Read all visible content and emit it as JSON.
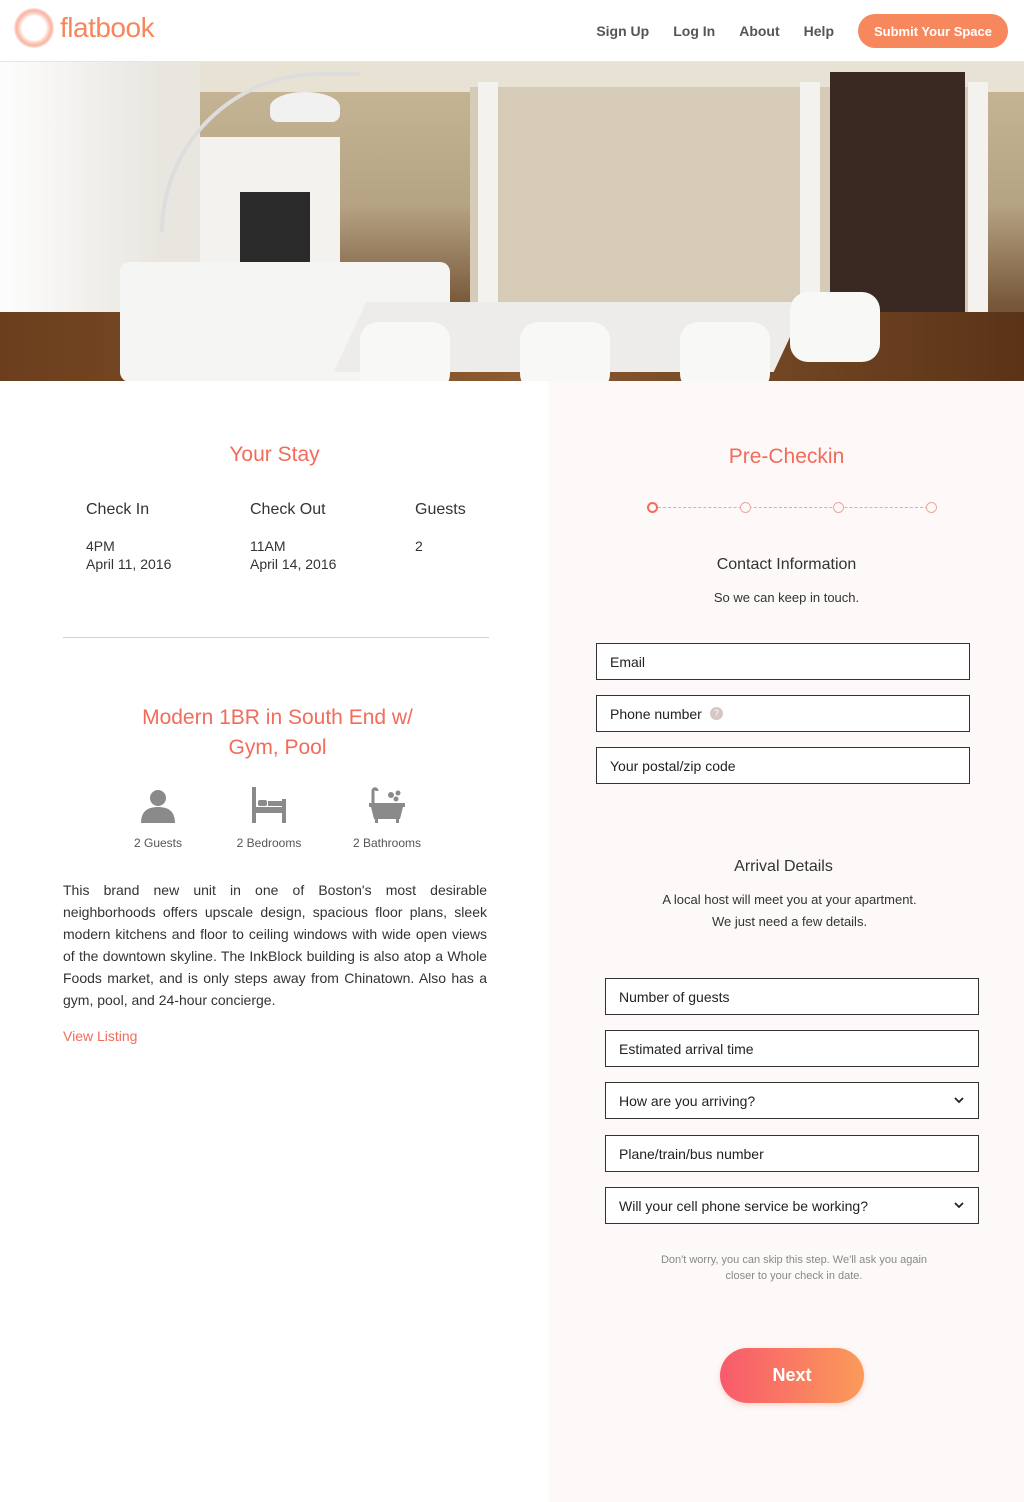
{
  "header": {
    "logo_text": "flatbook",
    "nav": [
      "Sign Up",
      "Log In",
      "About",
      "Help"
    ],
    "cta": "Submit Your Space"
  },
  "stay": {
    "title": "Your Stay",
    "check_in_label": "Check In",
    "check_in_time": "4PM",
    "check_in_date": "April 11, 2016",
    "check_out_label": "Check Out",
    "check_out_time": "11AM",
    "check_out_date": "April 14, 2016",
    "guests_label": "Guests",
    "guests_value": "2"
  },
  "listing": {
    "title_line1": "Modern 1BR in South End w/",
    "title_line2": "Gym, Pool",
    "amenities": [
      {
        "icon": "person-icon",
        "label": "2 Guests"
      },
      {
        "icon": "bed-icon",
        "label": "2 Bedrooms"
      },
      {
        "icon": "bathtub-icon",
        "label": "2 Bathrooms"
      }
    ],
    "description": "This brand new unit in one of Boston's most desirable neighborhoods offers upscale design, spacious floor plans, sleek modern kitchens and floor to ceiling windows with wide open views of the downtown skyline. The InkBlock building is also atop a Whole Foods market, and is only steps away from Chinatown. Also has a gym, pool, and 24-hour concierge.",
    "view_link": "View Listing"
  },
  "precheckin": {
    "title": "Pre-Checkin",
    "steps_total": 4,
    "current_step": 1,
    "contact": {
      "heading": "Contact Information",
      "subtext": "So we can keep in touch.",
      "fields": [
        "Email",
        "Phone number",
        "Your postal/zip code"
      ]
    },
    "arrival": {
      "heading": "Arrival Details",
      "subtext_line1": "A local host will meet you at your apartment.",
      "subtext_line2": "We just need a few details.",
      "fields": [
        "Number of guests",
        "Estimated arrival time",
        "How are you arriving?",
        "Plane/train/bus number",
        "Will your cell phone service be working?"
      ]
    },
    "note_line1": "Don't worry, you can skip this step. We'll ask you again",
    "note_line2": "closer to your check in date.",
    "next_label": "Next"
  },
  "colors": {
    "accent": "#f26b5b",
    "cta": "#f7875d",
    "next_gradient_start": "#f85a6c",
    "next_gradient_end": "#fa9b59"
  }
}
